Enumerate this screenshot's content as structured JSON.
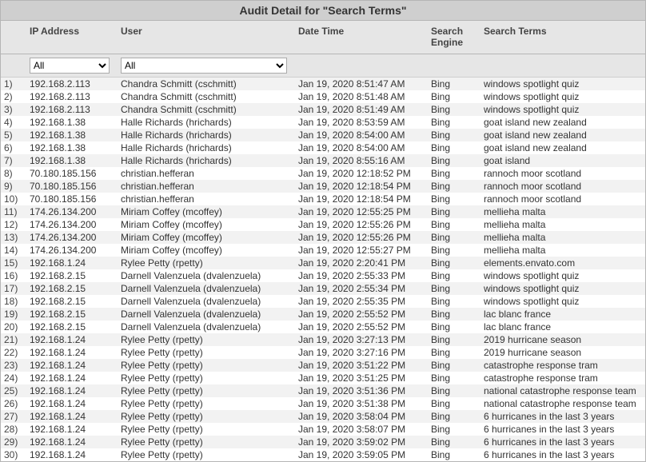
{
  "title": "Audit Detail for \"Search Terms\"",
  "columns": {
    "ip": "IP Address",
    "user": "User",
    "dt": "Date Time",
    "engine": "Search Engine",
    "terms": "Search Terms"
  },
  "filters": {
    "ip": "All",
    "user": "All"
  },
  "rows": [
    {
      "idx": "1)",
      "ip": "192.168.2.113",
      "user": "Chandra Schmitt (cschmitt)",
      "dt": "Jan 19, 2020 8:51:47 AM",
      "engine": "Bing",
      "terms": "windows spotlight quiz"
    },
    {
      "idx": "2)",
      "ip": "192.168.2.113",
      "user": "Chandra Schmitt (cschmitt)",
      "dt": "Jan 19, 2020 8:51:48 AM",
      "engine": "Bing",
      "terms": "windows spotlight quiz"
    },
    {
      "idx": "3)",
      "ip": "192.168.2.113",
      "user": "Chandra Schmitt (cschmitt)",
      "dt": "Jan 19, 2020 8:51:49 AM",
      "engine": "Bing",
      "terms": "windows spotlight quiz"
    },
    {
      "idx": "4)",
      "ip": "192.168.1.38",
      "user": "Halle Richards (hrichards)",
      "dt": "Jan 19, 2020 8:53:59 AM",
      "engine": "Bing",
      "terms": "goat island new zealand"
    },
    {
      "idx": "5)",
      "ip": "192.168.1.38",
      "user": "Halle Richards (hrichards)",
      "dt": "Jan 19, 2020 8:54:00 AM",
      "engine": "Bing",
      "terms": "goat island new zealand"
    },
    {
      "idx": "6)",
      "ip": "192.168.1.38",
      "user": "Halle Richards (hrichards)",
      "dt": "Jan 19, 2020 8:54:00 AM",
      "engine": "Bing",
      "terms": "goat island new zealand"
    },
    {
      "idx": "7)",
      "ip": "192.168.1.38",
      "user": "Halle Richards (hrichards)",
      "dt": "Jan 19, 2020 8:55:16 AM",
      "engine": "Bing",
      "terms": "goat island"
    },
    {
      "idx": "8)",
      "ip": "70.180.185.156",
      "user": "christian.hefferan",
      "dt": "Jan 19, 2020 12:18:52 PM",
      "engine": "Bing",
      "terms": "rannoch moor scotland"
    },
    {
      "idx": "9)",
      "ip": "70.180.185.156",
      "user": "christian.hefferan",
      "dt": "Jan 19, 2020 12:18:54 PM",
      "engine": "Bing",
      "terms": "rannoch moor scotland"
    },
    {
      "idx": "10)",
      "ip": "70.180.185.156",
      "user": "christian.hefferan",
      "dt": "Jan 19, 2020 12:18:54 PM",
      "engine": "Bing",
      "terms": "rannoch moor scotland"
    },
    {
      "idx": "11)",
      "ip": "174.26.134.200",
      "user": "Miriam Coffey (mcoffey)",
      "dt": "Jan 19, 2020 12:55:25 PM",
      "engine": "Bing",
      "terms": "mellieha malta"
    },
    {
      "idx": "12)",
      "ip": "174.26.134.200",
      "user": "Miriam Coffey (mcoffey)",
      "dt": "Jan 19, 2020 12:55:26 PM",
      "engine": "Bing",
      "terms": "mellieha malta"
    },
    {
      "idx": "13)",
      "ip": "174.26.134.200",
      "user": "Miriam Coffey (mcoffey)",
      "dt": "Jan 19, 2020 12:55:26 PM",
      "engine": "Bing",
      "terms": "mellieha malta"
    },
    {
      "idx": "14)",
      "ip": "174.26.134.200",
      "user": "Miriam Coffey (mcoffey)",
      "dt": "Jan 19, 2020 12:55:27 PM",
      "engine": "Bing",
      "terms": "mellieha malta"
    },
    {
      "idx": "15)",
      "ip": "192.168.1.24",
      "user": "Rylee Petty (rpetty)",
      "dt": "Jan 19, 2020 2:20:41 PM",
      "engine": "Bing",
      "terms": "elements.envato.com"
    },
    {
      "idx": "16)",
      "ip": "192.168.2.15",
      "user": "Darnell Valenzuela (dvalenzuela)",
      "dt": "Jan 19, 2020 2:55:33 PM",
      "engine": "Bing",
      "terms": "windows spotlight quiz"
    },
    {
      "idx": "17)",
      "ip": "192.168.2.15",
      "user": "Darnell Valenzuela (dvalenzuela)",
      "dt": "Jan 19, 2020 2:55:34 PM",
      "engine": "Bing",
      "terms": "windows spotlight quiz"
    },
    {
      "idx": "18)",
      "ip": "192.168.2.15",
      "user": "Darnell Valenzuela (dvalenzuela)",
      "dt": "Jan 19, 2020 2:55:35 PM",
      "engine": "Bing",
      "terms": "windows spotlight quiz"
    },
    {
      "idx": "19)",
      "ip": "192.168.2.15",
      "user": "Darnell Valenzuela (dvalenzuela)",
      "dt": "Jan 19, 2020 2:55:52 PM",
      "engine": "Bing",
      "terms": "lac blanc france"
    },
    {
      "idx": "20)",
      "ip": "192.168.2.15",
      "user": "Darnell Valenzuela (dvalenzuela)",
      "dt": "Jan 19, 2020 2:55:52 PM",
      "engine": "Bing",
      "terms": "lac blanc france"
    },
    {
      "idx": "21)",
      "ip": "192.168.1.24",
      "user": "Rylee Petty (rpetty)",
      "dt": "Jan 19, 2020 3:27:13 PM",
      "engine": "Bing",
      "terms": "2019 hurricane season"
    },
    {
      "idx": "22)",
      "ip": "192.168.1.24",
      "user": "Rylee Petty (rpetty)",
      "dt": "Jan 19, 2020 3:27:16 PM",
      "engine": "Bing",
      "terms": "2019 hurricane season"
    },
    {
      "idx": "23)",
      "ip": "192.168.1.24",
      "user": "Rylee Petty (rpetty)",
      "dt": "Jan 19, 2020 3:51:22 PM",
      "engine": "Bing",
      "terms": "catastrophe response tram"
    },
    {
      "idx": "24)",
      "ip": "192.168.1.24",
      "user": "Rylee Petty (rpetty)",
      "dt": "Jan 19, 2020 3:51:25 PM",
      "engine": "Bing",
      "terms": "catastrophe response tram"
    },
    {
      "idx": "25)",
      "ip": "192.168.1.24",
      "user": "Rylee Petty (rpetty)",
      "dt": "Jan 19, 2020 3:51:36 PM",
      "engine": "Bing",
      "terms": "national catastrophe response team"
    },
    {
      "idx": "26)",
      "ip": "192.168.1.24",
      "user": "Rylee Petty (rpetty)",
      "dt": "Jan 19, 2020 3:51:38 PM",
      "engine": "Bing",
      "terms": "national catastrophe response team"
    },
    {
      "idx": "27)",
      "ip": "192.168.1.24",
      "user": "Rylee Petty (rpetty)",
      "dt": "Jan 19, 2020 3:58:04 PM",
      "engine": "Bing",
      "terms": "6 hurricanes in the last 3 years"
    },
    {
      "idx": "28)",
      "ip": "192.168.1.24",
      "user": "Rylee Petty (rpetty)",
      "dt": "Jan 19, 2020 3:58:07 PM",
      "engine": "Bing",
      "terms": "6 hurricanes in the last 3 years"
    },
    {
      "idx": "29)",
      "ip": "192.168.1.24",
      "user": "Rylee Petty (rpetty)",
      "dt": "Jan 19, 2020 3:59:02 PM",
      "engine": "Bing",
      "terms": "6 hurricanes in the last 3 years"
    },
    {
      "idx": "30)",
      "ip": "192.168.1.24",
      "user": "Rylee Petty (rpetty)",
      "dt": "Jan 19, 2020 3:59:05 PM",
      "engine": "Bing",
      "terms": "6 hurricanes in the last 3 years"
    }
  ]
}
